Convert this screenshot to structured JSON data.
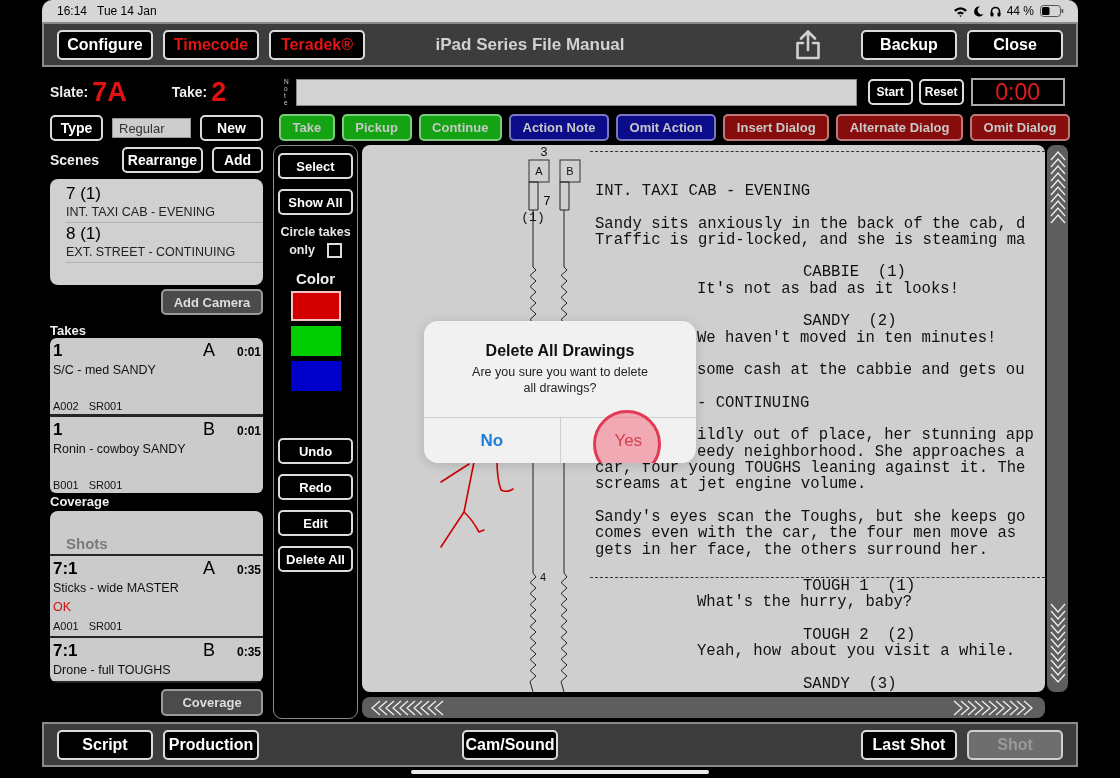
{
  "status_bar": {
    "time": "16:14",
    "date": "Tue 14 Jan",
    "battery": "44 %"
  },
  "top_bar": {
    "left_buttons": [
      {
        "label": "Configure",
        "kind": "normal"
      },
      {
        "label": "Timecode",
        "kind": "alert"
      },
      {
        "label": "Teradek®",
        "kind": "alert"
      }
    ],
    "title": "iPad Series File Manual",
    "right_buttons": [
      {
        "label": "Backup"
      },
      {
        "label": "Close"
      }
    ]
  },
  "slate": {
    "label": "Slate:",
    "value": "7A"
  },
  "take": {
    "label": "Take:",
    "value": "2"
  },
  "type_button": "Type",
  "type_field": {
    "value": "Regular"
  },
  "new_button": "New",
  "scenes": {
    "label": "Scenes",
    "buttons": [
      "Rearrange",
      "Add"
    ],
    "items": [
      {
        "number": "7 (1)",
        "heading": "INT. TAXI CAB - EVENING"
      },
      {
        "number": "8 (1)",
        "heading": "EXT. STREET - CONTINUING"
      }
    ]
  },
  "add_camera_button": "Add Camera",
  "takes": {
    "label": "Takes",
    "items": [
      {
        "number": "1",
        "camera": "A",
        "duration": "0:01",
        "description": "S/C - med SANDY",
        "roll": "A002",
        "sound_roll": "SR001"
      },
      {
        "number": "1",
        "camera": "B",
        "duration": "0:01",
        "description": "Ronin - cowboy SANDY",
        "roll": "B001",
        "sound_roll": "SR001"
      }
    ]
  },
  "coverage": {
    "label": "Coverage",
    "header": "Shots",
    "items": [
      {
        "number": "7:1",
        "camera": "A",
        "duration": "0:35",
        "description": "Sticks - wide MASTER",
        "status": "OK",
        "roll": "A001",
        "sound_roll": "SR001"
      },
      {
        "number": "7:1",
        "camera": "B",
        "duration": "0:35",
        "description": "Drone - full TOUGHS"
      }
    ],
    "button": "Coverage"
  },
  "note": {
    "label": "Note"
  },
  "timer": {
    "buttons": [
      "Start",
      "Reset"
    ],
    "display": "0:00"
  },
  "tag_buttons": [
    {
      "label": "Take",
      "color": "#13a313"
    },
    {
      "label": "Pickup",
      "color": "#13a313"
    },
    {
      "label": "Continue",
      "color": "#13a313"
    },
    {
      "label": "Action Note",
      "color": "#0c0c8a"
    },
    {
      "label": "Omit Action",
      "color": "#0c0c8a"
    },
    {
      "label": "Insert Dialog",
      "color": "#870c0c"
    },
    {
      "label": "Alternate Dialog",
      "color": "#870c0c"
    },
    {
      "label": "Omit Dialog",
      "color": "#870c0c"
    }
  ],
  "tools": {
    "buttons_top": [
      "Select",
      "Show All"
    ],
    "circle_takes": {
      "label_lines": [
        "Circle takes",
        "only"
      ],
      "checked": false
    },
    "color_label": "Color",
    "colors": [
      {
        "color": "#d40000",
        "selected": true
      },
      {
        "color": "#00cc00",
        "selected": false
      },
      {
        "color": "#0000cc",
        "selected": false
      }
    ],
    "buttons_bottom": [
      "Undo",
      "Redo",
      "Edit",
      "Delete All"
    ]
  },
  "lining": {
    "scene_number": "3",
    "setups": [
      {
        "label": "A"
      },
      {
        "label": "B"
      }
    ],
    "take_number": "7",
    "take_count": "(1)",
    "next_scene_number": "4"
  },
  "script": {
    "blocks": [
      {
        "kind": "break"
      },
      {
        "kind": "heading",
        "lines": [
          "INT. TAXI CAB - EVENING"
        ]
      },
      {
        "kind": "action",
        "lines": [
          "Sandy sits anxiously in the back of the cab, d",
          "Traffic is grid-locked, and she is steaming ma"
        ]
      },
      {
        "kind": "character",
        "lines": [
          "CABBIE  (1)"
        ]
      },
      {
        "kind": "dialogue",
        "lines": [
          "It's not as bad as it looks!"
        ]
      },
      {
        "kind": "character",
        "lines": [
          "SANDY  (2)"
        ]
      },
      {
        "kind": "dialogue",
        "lines": [
          "We haven't moved in ten minutes!"
        ]
      },
      {
        "kind": "partial",
        "lines": [
          "some cash at the cabbie and gets ou"
        ]
      },
      {
        "kind": "partial",
        "lines": [
          "- CONTINUING"
        ]
      },
      {
        "kind": "partial",
        "lines": [
          "ildly out of place, her stunning app",
          "eedy neighborhood. She approaches a"
        ]
      },
      {
        "kind": "action",
        "lines": [
          "car, four young TOUGHS leaning against it. The",
          "screams at jet engine volume."
        ]
      },
      {
        "kind": "action",
        "lines": [
          "Sandy's eyes scan the Toughs, but she keeps go",
          "comes even with the car, the four men move as",
          "gets in her face, the others surround her."
        ]
      },
      {
        "kind": "break"
      },
      {
        "kind": "character",
        "lines": [
          "TOUGH 1  (1)"
        ]
      },
      {
        "kind": "dialogue",
        "lines": [
          "What's the hurry, baby?"
        ]
      },
      {
        "kind": "character",
        "lines": [
          "TOUGH 2  (2)"
        ]
      },
      {
        "kind": "dialogue",
        "lines": [
          "Yeah, how about you visit a while."
        ]
      },
      {
        "kind": "character",
        "lines": [
          "SANDY  (3)"
        ]
      }
    ]
  },
  "dialog": {
    "title": "Delete All Drawings",
    "message": "Are you sure you want to delete all drawings?",
    "buttons": [
      {
        "label": "No",
        "kind": "cancel",
        "pressed": false
      },
      {
        "label": "Yes",
        "kind": "destructive",
        "pressed": true
      }
    ]
  },
  "bottom_bar": {
    "left": [
      "Script",
      "Production"
    ],
    "center": [
      "Cam/Sound"
    ],
    "right": [
      {
        "label": "Last Shot",
        "disabled": false
      },
      {
        "label": "Shot",
        "disabled": true
      }
    ]
  }
}
